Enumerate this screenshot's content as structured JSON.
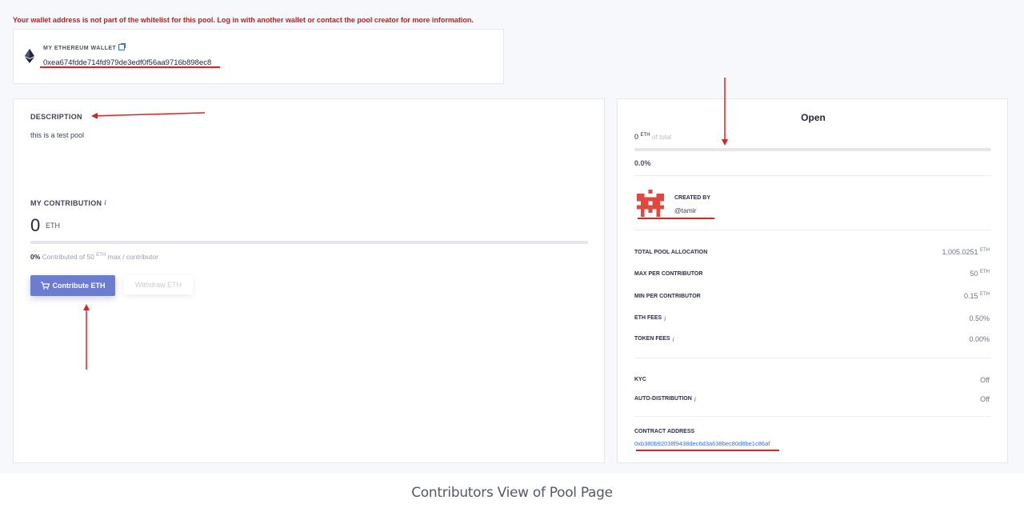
{
  "warning": "Your wallet address is not part of the whitelist for this pool. Log in with another wallet or contact the pool creator for more information.",
  "wallet": {
    "title": "MY ETHEREUM WALLET",
    "address": "0xea674fdde714fd979de3edf0f56aa9716b898ec8"
  },
  "description": {
    "title": "DESCRIPTION",
    "text": "this is a test pool"
  },
  "contribution": {
    "title": "MY CONTRIBUTION",
    "amount": "0",
    "unit": "ETH",
    "percent": "0%",
    "note_prefix": "Contributed of",
    "max": "50",
    "unit_sup": "ETH",
    "note_suffix": "max / contributor",
    "progress_fraction": 0
  },
  "buttons": {
    "contribute": "Contribute ETH",
    "withdraw": "Withdraw ETH"
  },
  "pool": {
    "status": "Open",
    "raised": "0",
    "raised_unit": "ETH",
    "raised_suffix": "of total",
    "percent": "0.0%",
    "progress_fraction": 0,
    "created_label": "CREATED BY",
    "creator": "@tamir"
  },
  "details": [
    {
      "label": "TOTAL POOL ALLOCATION",
      "value": "1,005.0251",
      "unit": "ETH"
    },
    {
      "label": "MAX PER CONTRIBUTOR",
      "value": "50",
      "unit": "ETH"
    },
    {
      "label": "MIN PER CONTRIBUTOR",
      "value": "0.15",
      "unit": "ETH"
    },
    {
      "label": "ETH FEES",
      "value": "0.50%",
      "unit": ""
    },
    {
      "label": "TOKEN FEES",
      "value": "0.00%",
      "unit": ""
    }
  ],
  "settings": [
    {
      "label": "KYC",
      "value": "Off"
    },
    {
      "label": "AUTO-DISTRIBUTION",
      "value": "Off"
    }
  ],
  "contract": {
    "label": "CONTRACT ADDRESS",
    "address": "0xb380b92038f9438dec6d3a638bec80d8be1c86af"
  },
  "caption": "Contributors View of Pool Page",
  "colors": {
    "warning": "#c41e1e",
    "primary_button": "#6c7ccf",
    "link": "#3a6fd8",
    "annotation": "#e02020",
    "avatar": "#e0483e"
  },
  "icons": {
    "wallet": "ethereum-icon",
    "external": "external-link-icon",
    "info": "info-icon",
    "cart": "cart-icon"
  }
}
